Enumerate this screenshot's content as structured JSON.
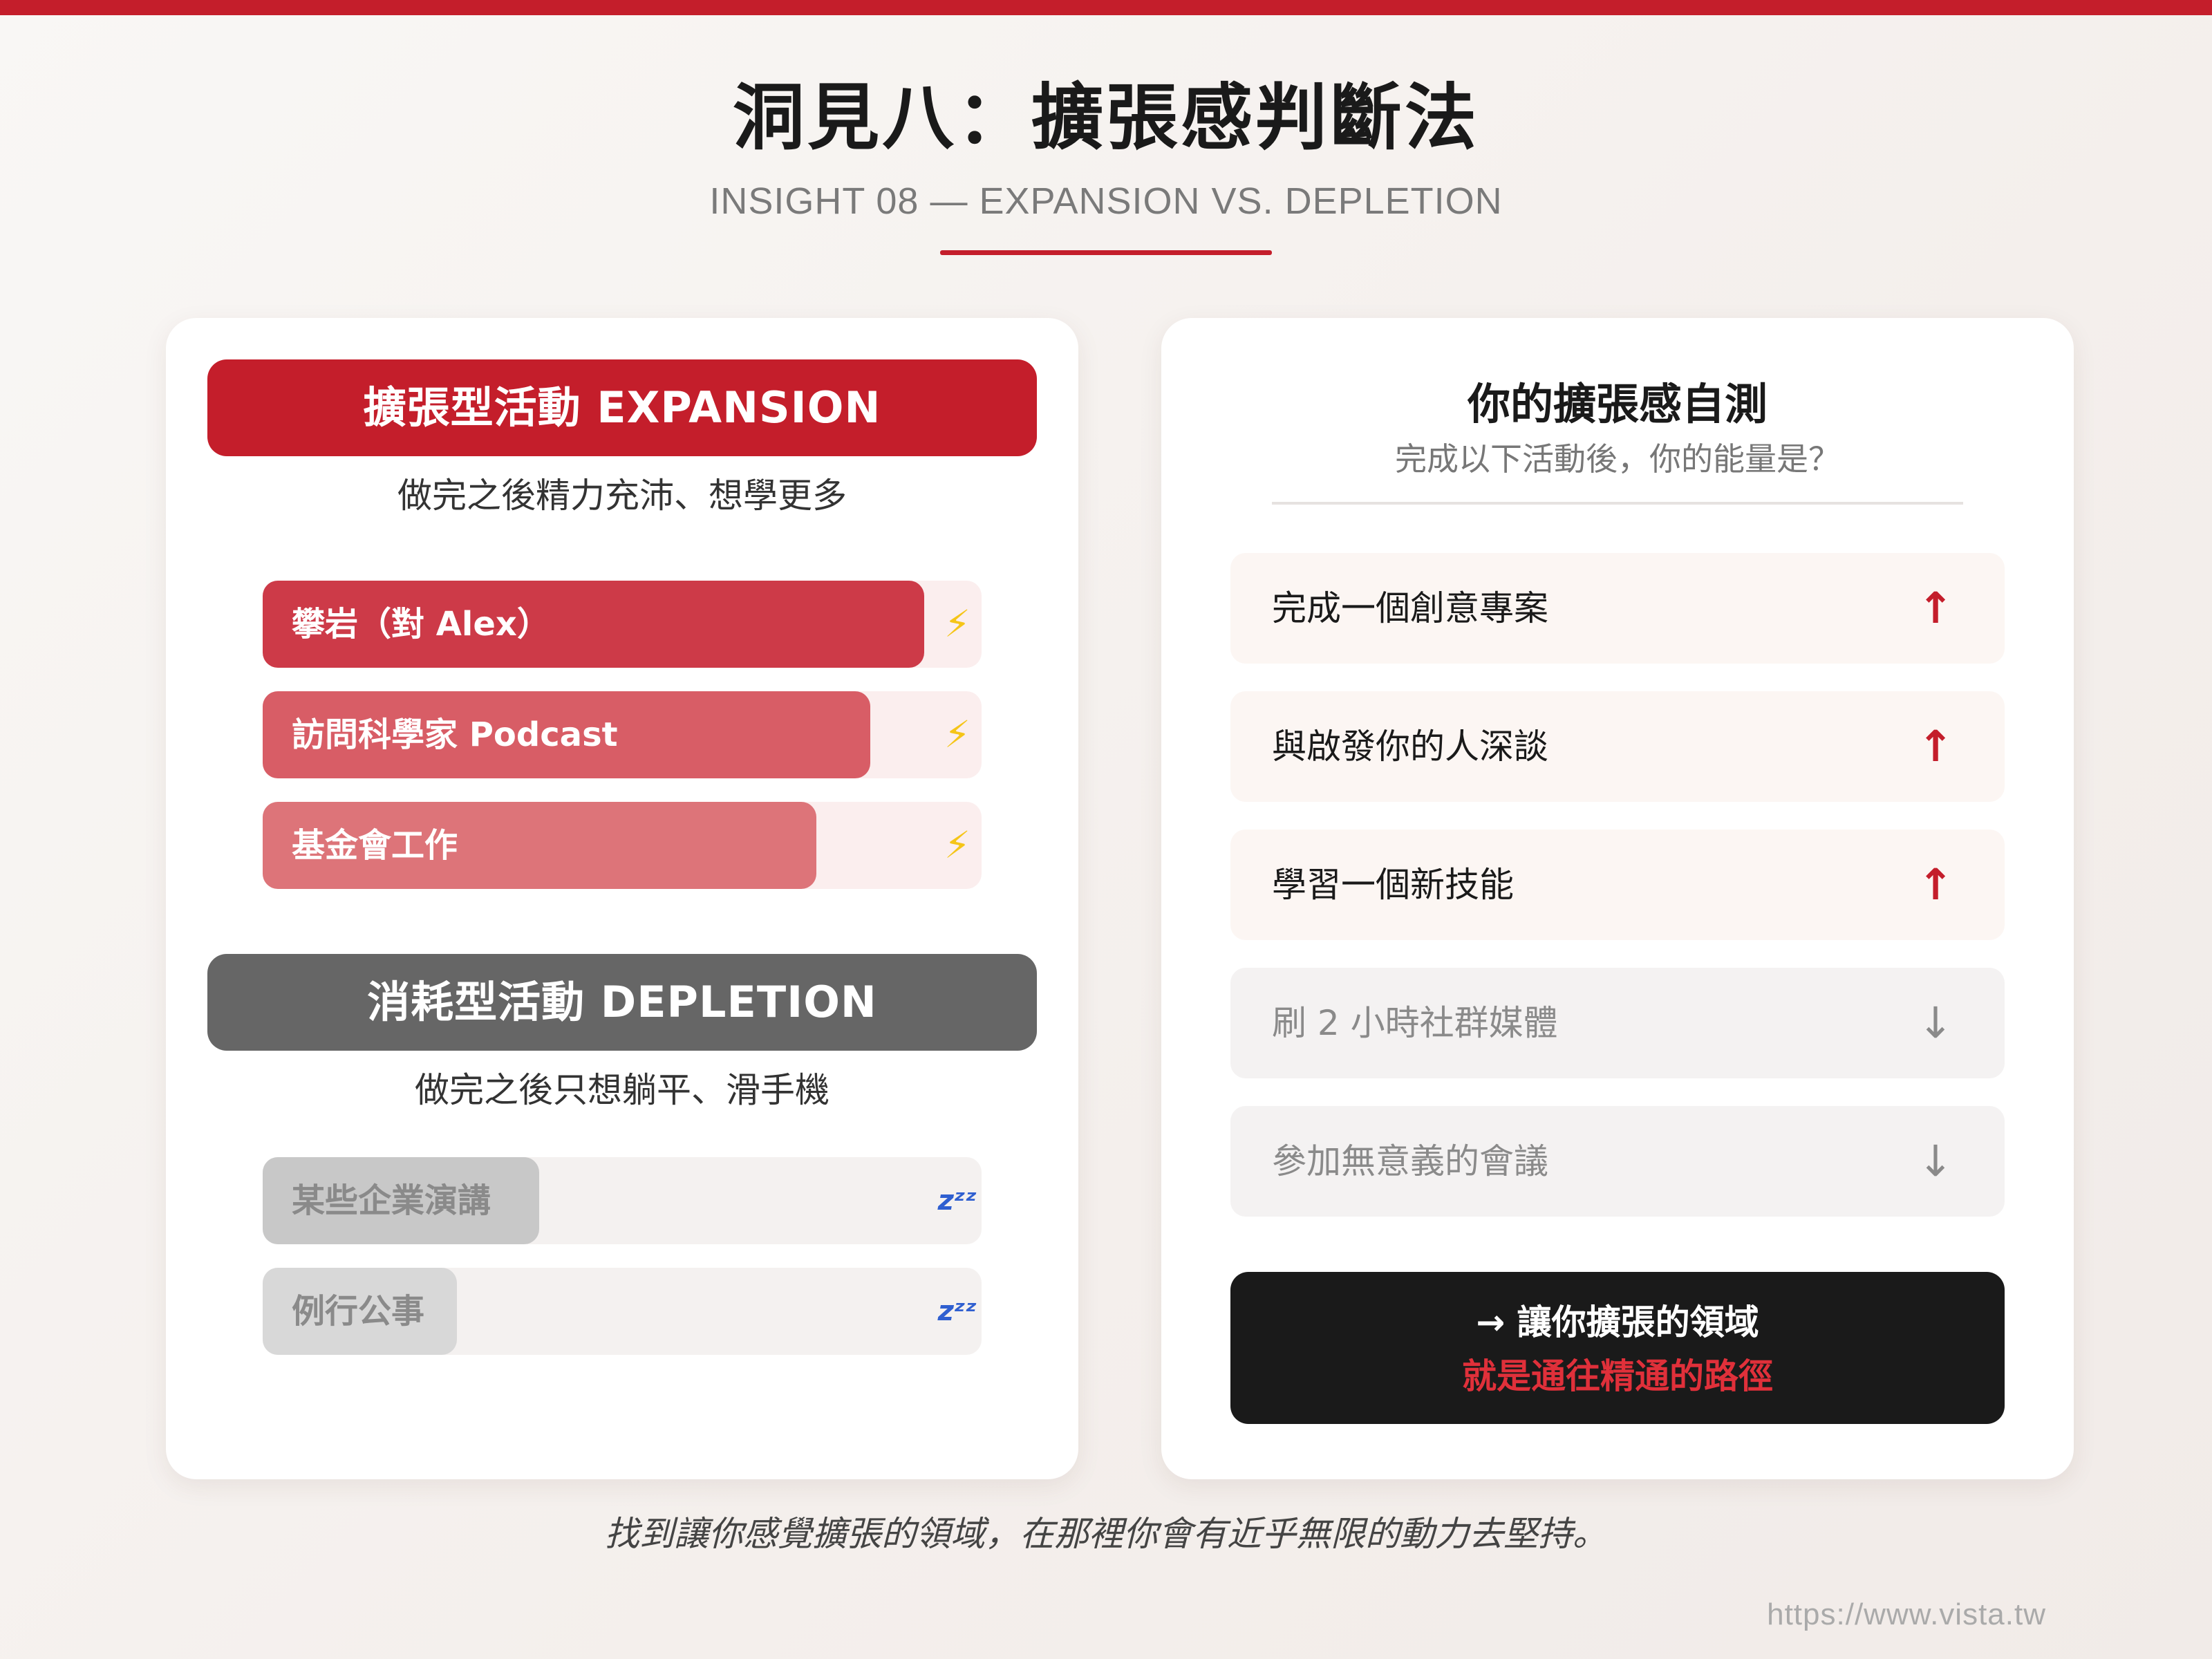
{
  "header": {
    "title": "洞見八：擴張感判斷法",
    "subtitle": "INSIGHT 08 — EXPANSION VS. DEPLETION"
  },
  "colors": {
    "accent": "#c41e2b",
    "depletion": "#666666",
    "dark": "#1a1a1a"
  },
  "expansion": {
    "heading": "擴張型活動 EXPANSION",
    "description": "做完之後精力充沛、想學更多",
    "icon": "lightning-icon",
    "icon_glyph": "⚡",
    "items": [
      {
        "label": "攀岩（對 Alex）",
        "level": 0.92,
        "color": "#cd3a48"
      },
      {
        "label": "訪問科學家 Podcast",
        "level": 0.845,
        "color": "#d85d66"
      },
      {
        "label": "基金會工作",
        "level": 0.77,
        "color": "#dd7479"
      }
    ]
  },
  "depletion": {
    "heading": "消耗型活動 DEPLETION",
    "description": "做完之後只想躺平、滑手機",
    "icon": "sleep-icon",
    "icon_glyph": "zᶻᶻ",
    "items": [
      {
        "label": "某些企業演講",
        "level": 0.385,
        "color": "#c8c8c8"
      },
      {
        "label": "例行公事",
        "level": 0.27,
        "color": "#d8d8d8"
      }
    ]
  },
  "self_test": {
    "title": "你的擴張感自測",
    "subtitle": "完成以下活動後，你的能量是？",
    "items": [
      {
        "label": "完成一個創意專案",
        "direction": "up",
        "arrow": "↑"
      },
      {
        "label": "與啟發你的人深談",
        "direction": "up",
        "arrow": "↑"
      },
      {
        "label": "學習一個新技能",
        "direction": "up",
        "arrow": "↑"
      },
      {
        "label": "刷 2 小時社群媒體",
        "direction": "down",
        "arrow": "↓"
      },
      {
        "label": "參加無意義的會議",
        "direction": "down",
        "arrow": "↓"
      }
    ],
    "cta_line1": "→ 讓你擴張的領域",
    "cta_line2": "就是通往精通的路徑"
  },
  "footer": {
    "quote": "找到讓你感覺擴張的領域，在那裡你會有近乎無限的動力去堅持。",
    "url": "https://www.vista.tw"
  }
}
